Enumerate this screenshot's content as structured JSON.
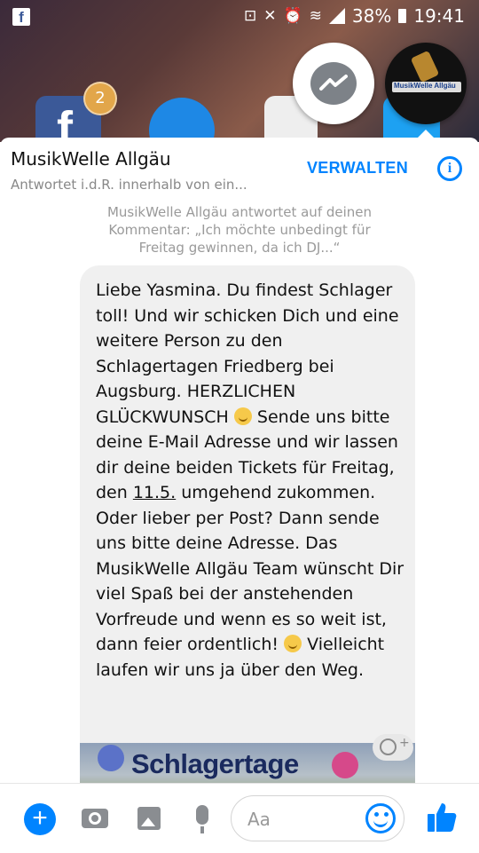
{
  "status_bar": {
    "battery_percent": "38%",
    "time": "19:41",
    "app_icon": "facebook-icon"
  },
  "home_badge_count": "2",
  "header": {
    "name": "MusikWelle Allgäu",
    "subtitle": "Antwortet i.d.R. innerhalb von ein...",
    "manage_label": "VERWALTEN",
    "info_icon": "info-icon"
  },
  "chathead": {
    "logo_text": "MusikWelle Allgäu"
  },
  "chat": {
    "reply_note": "MusikWelle Allgäu antwortet auf deinen Kommentar: „Ich möchte unbedingt für Freitag gewinnen, da ich DJ...“",
    "message": {
      "part1": "Liebe Yasmina. Du findest Schlager toll! Und wir schicken Dich und eine weitere Person zu den Schlagertagen Friedberg bei Augsburg. HERZLICHEN GLÜCKWUNSCH ",
      "part2": " Sende uns bitte deine E-Mail Adresse und wir lassen dir deine beiden Tickets für Freitag, den ",
      "date": "11.5.",
      "part3": " umgehend zukommen. Oder lieber per Post? Dann sende uns bitte deine Adresse. Das MusikWelle Allgäu Team wünscht Dir viel Spaß bei der anstehenden Vorfreude und wenn es so weit ist, dann feier ordentlich! ",
      "part4": " Vielleicht laufen wir uns ja über den Weg."
    },
    "banner_text": "Schlagertage"
  },
  "composer": {
    "placeholder": "Aa"
  }
}
